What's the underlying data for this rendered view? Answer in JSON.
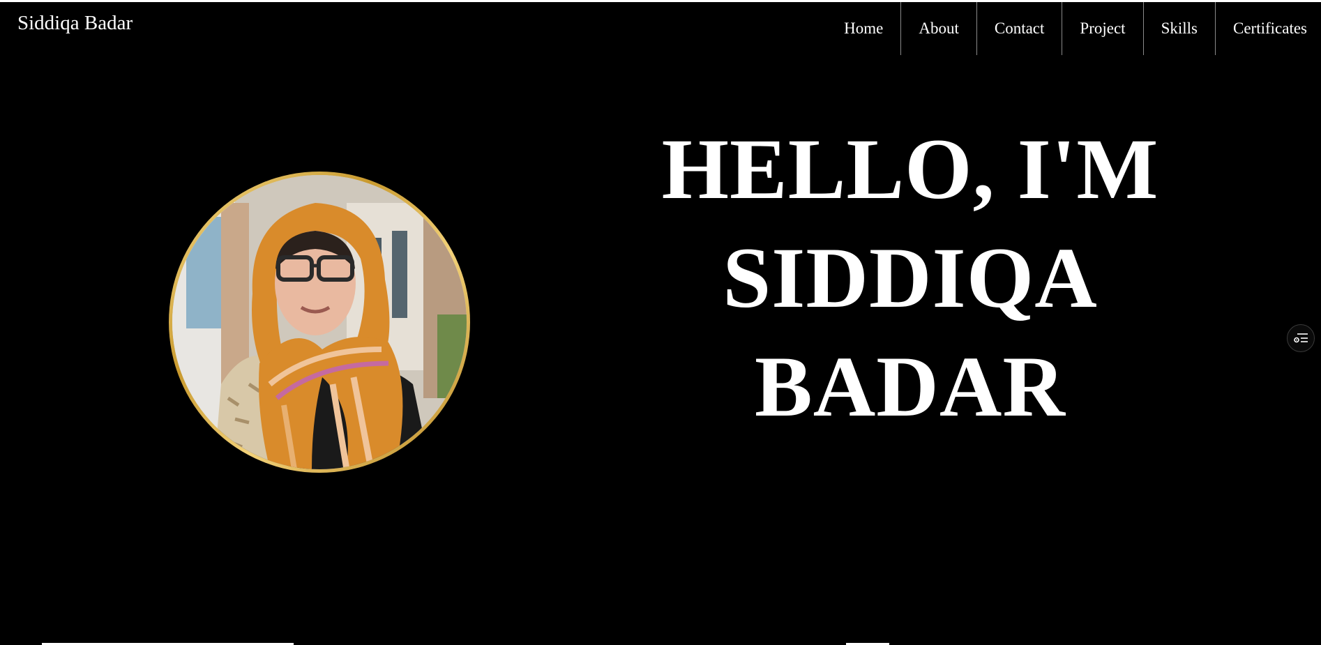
{
  "header": {
    "brand": "Siddiqa Badar"
  },
  "nav": {
    "items": [
      {
        "label": "Home"
      },
      {
        "label": "About"
      },
      {
        "label": "Contact"
      },
      {
        "label": "Project"
      },
      {
        "label": "Skills"
      },
      {
        "label": "Certificates"
      }
    ]
  },
  "hero": {
    "line1": "HELLO, I'M",
    "line2": "SIDDIQA",
    "line3": "BADAR"
  },
  "profile_photo": {
    "icon": "profile-photo"
  },
  "floating": {
    "icon": "settings-list-icon"
  },
  "colors": {
    "background": "#000000",
    "text": "#ffffff",
    "avatar_ring": "#d4a83a",
    "scarf": "#d98b2b"
  }
}
